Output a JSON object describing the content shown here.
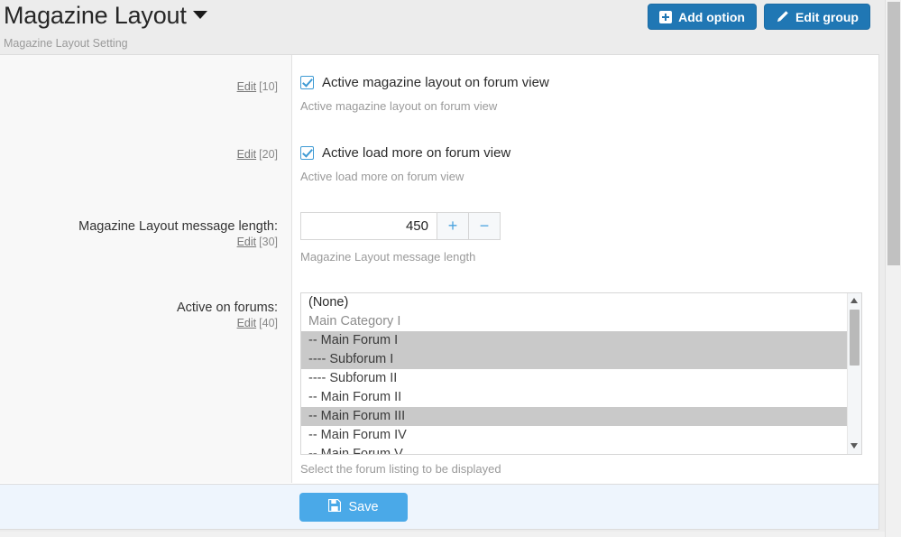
{
  "header": {
    "title": "Magazine Layout",
    "caret_icon": "caret-down-icon",
    "subtitle": "Magazine Layout Setting",
    "buttons": [
      {
        "label": "Add option",
        "icon": "plus-square-icon",
        "color": "#2077b4"
      },
      {
        "label": "Edit group",
        "icon": "pencil-icon",
        "color": "#2077b4"
      }
    ]
  },
  "rows": [
    {
      "label": "",
      "edit_label": "Edit",
      "edit_number": "[10]",
      "type": "checkbox",
      "checked": true,
      "checkbox_label": "Active magazine layout on forum view",
      "help": "Active magazine layout on forum view"
    },
    {
      "label": "",
      "edit_label": "Edit",
      "edit_number": "[20]",
      "type": "checkbox",
      "checked": true,
      "checkbox_label": "Active load more on forum view",
      "help": "Active load more on forum view"
    },
    {
      "label": "Magazine Layout message length:",
      "edit_label": "Edit",
      "edit_number": "[30]",
      "type": "number",
      "value": "450",
      "increment_label": "+",
      "decrement_label": "−",
      "help": "Magazine Layout message length"
    },
    {
      "label": "Active on forums:",
      "edit_label": "Edit",
      "edit_number": "[40]",
      "type": "listbox",
      "help": "Select the forum listing to be displayed"
    }
  ],
  "listbox": {
    "options": [
      {
        "label": "(None)",
        "style": "dark",
        "selected": false
      },
      {
        "label": "Main Category I",
        "style": "muted",
        "selected": false
      },
      {
        "label": "-- Main Forum I",
        "style": "",
        "selected": true
      },
      {
        "label": "---- Subforum I",
        "style": "",
        "selected": true
      },
      {
        "label": "---- Subforum II",
        "style": "",
        "selected": false
      },
      {
        "label": "-- Main Forum II",
        "style": "",
        "selected": false
      },
      {
        "label": "-- Main Forum III",
        "style": "",
        "selected": true
      },
      {
        "label": "-- Main Forum IV",
        "style": "",
        "selected": false
      },
      {
        "label": "-- Main Forum V",
        "style": "",
        "selected": false
      }
    ],
    "scroll_up_icon": "triangle-up-icon",
    "scroll_down_icon": "triangle-down-icon",
    "selection_color": "#c9c9c9"
  },
  "footer": {
    "save_label": "Save",
    "save_icon": "floppy-disk-icon",
    "save_color": "#4aa9e8"
  }
}
